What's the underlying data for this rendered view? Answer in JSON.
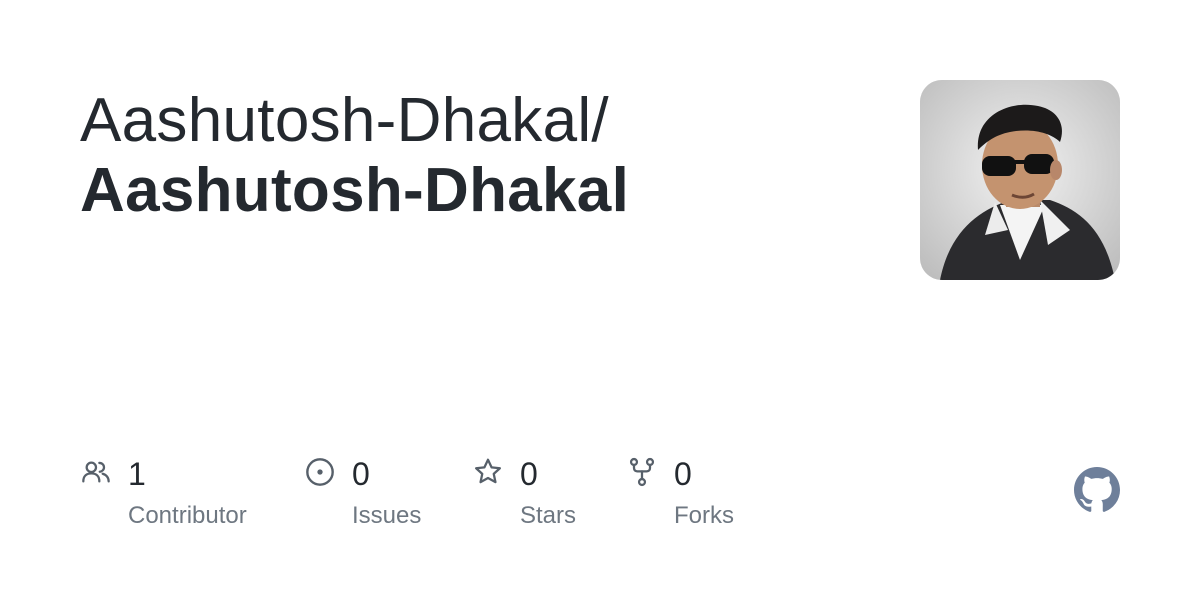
{
  "repo_card": {
    "owner": "Aashutosh-Dhakal/",
    "repo_name": "Aashutosh-Dhakal",
    "avatar": {
      "icon": "profile-photo-avatar"
    },
    "stats": {
      "contributors": {
        "count": "1",
        "label": "Contributor",
        "icon": "people-icon"
      },
      "issues": {
        "count": "0",
        "label": "Issues",
        "icon": "issue-opened-icon"
      },
      "stars": {
        "count": "0",
        "label": "Stars",
        "icon": "star-icon"
      },
      "forks": {
        "count": "0",
        "label": "Forks",
        "icon": "repo-forked-icon"
      }
    },
    "brand": {
      "icon": "github-mark-icon"
    }
  },
  "colors": {
    "text_primary": "#24292f",
    "text_secondary": "#6e7781",
    "icon_gray": "#57606a",
    "github_mark": "#6e7f9a",
    "background": "#ffffff"
  }
}
